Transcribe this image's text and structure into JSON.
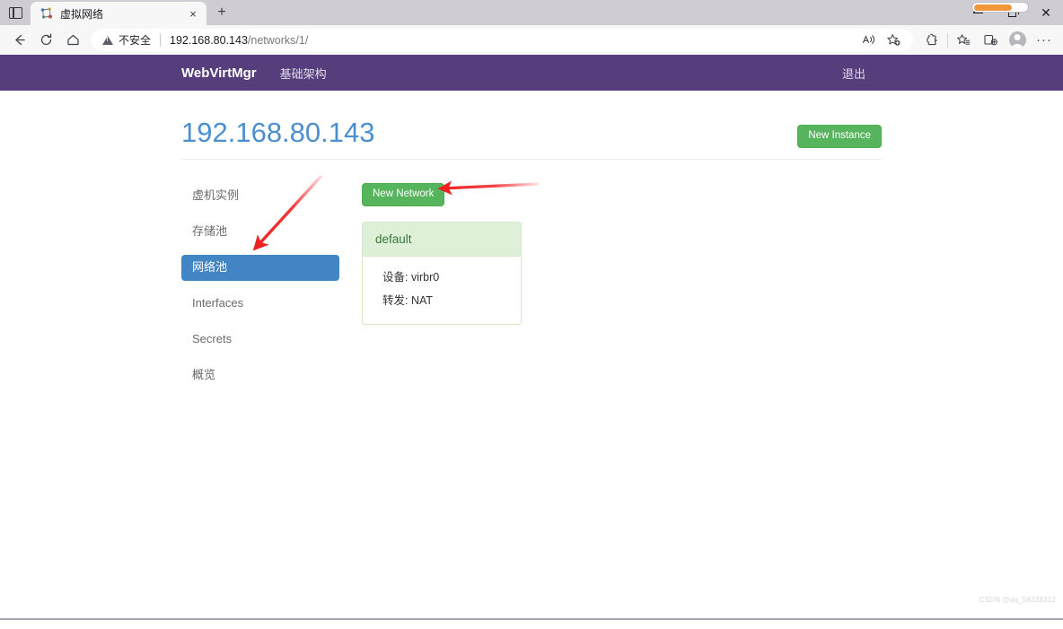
{
  "browser": {
    "tab": {
      "title": "虚拟网络",
      "favicon_icon": "network-favicon",
      "close_icon": "×"
    },
    "new_tab_icon": "+",
    "tab_actions_icon": "tab-actions-icon",
    "window_controls": {
      "minimize_icon": "minimize-icon",
      "maximize_icon": "restore-icon",
      "close_icon": "✕"
    },
    "toolbar": {
      "back_icon": "←",
      "refresh_icon": "⟳",
      "home_icon": "⌂",
      "security_label": "不安全",
      "url_host": "192.168.80.143",
      "url_path": "/networks/1/",
      "read_aloud_icon": "read-aloud-icon",
      "add_favorite_icon": "add-favorite-icon",
      "split_screen_icon": "browser-essentials-icon",
      "favorites_icon": "favorites-icon",
      "collections_icon": "collections-icon",
      "profile_icon": "profile-avatar-icon",
      "settings_icon": "···"
    }
  },
  "navbar": {
    "brand": "WebVirtMgr",
    "links": [
      {
        "label": "基础架构"
      }
    ],
    "logout_label": "退出",
    "bg_color": "#563d7c"
  },
  "page": {
    "title": "192.168.80.143",
    "title_color": "#4b8fd0",
    "new_instance_label": "New Instance",
    "button_color": "#56b45d"
  },
  "sidebar": {
    "items": [
      {
        "label": "虚机实例",
        "active": false
      },
      {
        "label": "存储池",
        "active": false
      },
      {
        "label": "网络池",
        "active": true
      },
      {
        "label": "Interfaces",
        "active": false
      },
      {
        "label": "Secrets",
        "active": false
      },
      {
        "label": "概览",
        "active": false
      }
    ],
    "active_color": "#4285c5"
  },
  "main": {
    "new_network_label": "New Network",
    "panels": [
      {
        "title": "default",
        "rows": [
          {
            "label": "设备:",
            "value": "virbr0"
          },
          {
            "label": "转发:",
            "value": "NAT"
          }
        ]
      }
    ],
    "panel_header_bg": "#dff0d8",
    "panel_header_color": "#3c763d"
  },
  "annotations": {
    "arrow_color": "#ee2222",
    "arrow_sidebar_target": "网络池",
    "arrow_button_target": "New Network"
  },
  "watermark": {
    "text": "CSDN @qq_58328312"
  }
}
